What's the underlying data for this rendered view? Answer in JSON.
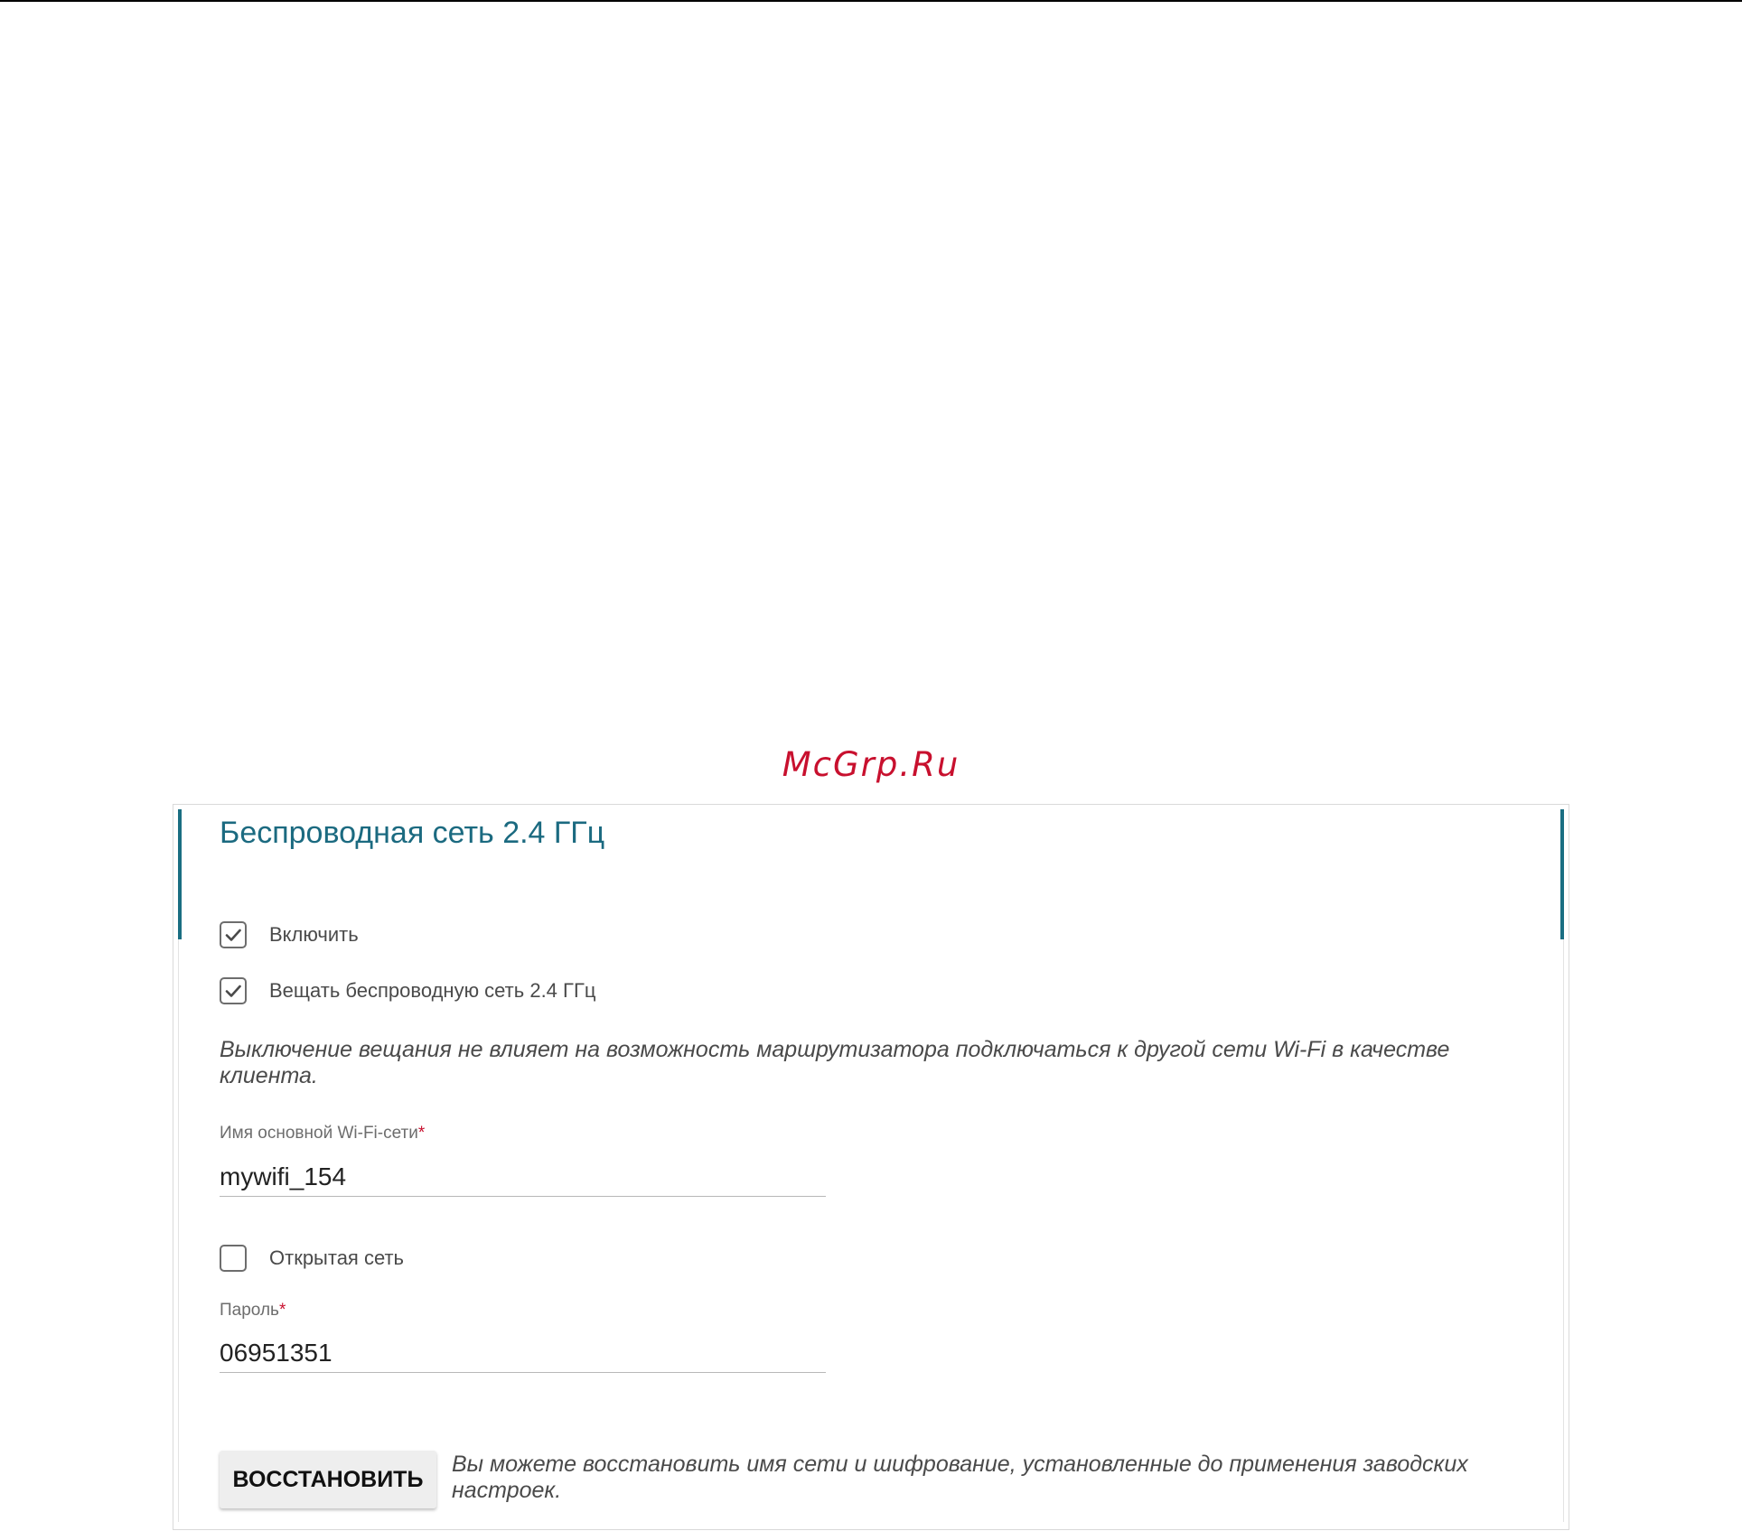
{
  "watermark": "McGrp.Ru",
  "section": {
    "title": "Беспроводная сеть 2.4 ГГц"
  },
  "enable": {
    "label": "Включить",
    "checked": true
  },
  "broadcast": {
    "label": "Вещать беспроводную сеть 2.4 ГГц",
    "checked": true
  },
  "broadcast_note": "Выключение вещания не влияет на возможность маршрутизатора подключаться к другой сети Wi-Fi в качестве клиента.",
  "ssid": {
    "label": "Имя основной Wi-Fi-сети",
    "required_mark": "*",
    "value": "mywifi_154"
  },
  "open_network": {
    "label": "Открытая сеть",
    "checked": false
  },
  "password": {
    "label": "Пароль",
    "required_mark": "*",
    "value": "06951351"
  },
  "restore": {
    "button_label": "ВОССТАНОВИТЬ",
    "note": "Вы можете восстановить имя сети и шифрование, установленные до применения заводских настроек."
  },
  "colors": {
    "accent": "#1a6e82",
    "title": "#1b6a80",
    "required": "#c8102e",
    "watermark": "#c8102e"
  },
  "icons": {
    "checkmark": "check-icon"
  }
}
